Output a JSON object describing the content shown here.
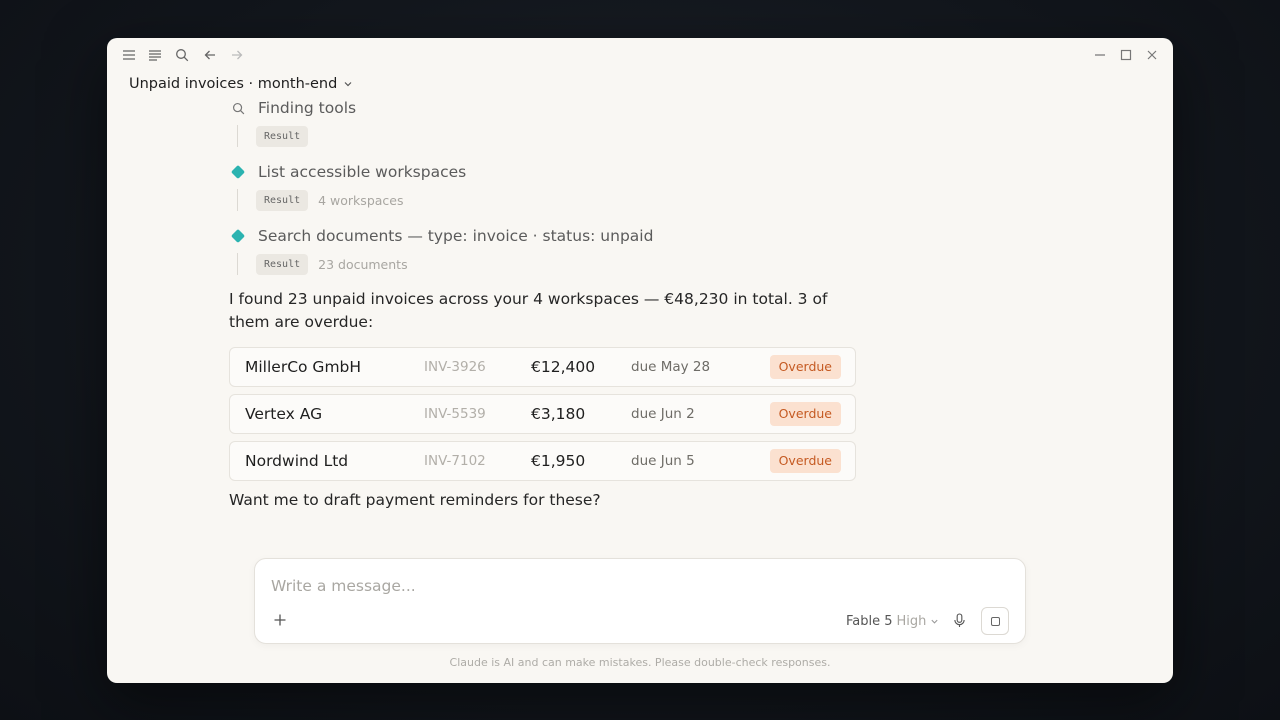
{
  "window": {
    "conversation_title": "Unpaid invoices · month-end"
  },
  "toolbar": {
    "icons": [
      "sidebar-toggle-icon",
      "menu-icon",
      "search-icon",
      "back-arrow-icon",
      "forward-arrow-icon"
    ],
    "window_controls": [
      "minimize-icon",
      "maximize-icon",
      "close-icon"
    ]
  },
  "steps": [
    {
      "icon": "search-icon",
      "label": "Finding tools",
      "result_label": "Result",
      "result_meta": ""
    },
    {
      "icon": "diamond-icon",
      "label": "List accessible workspaces",
      "result_label": "Result",
      "result_meta": "4 workspaces"
    },
    {
      "icon": "diamond-icon",
      "label": "Search documents — type: invoice · status: unpaid",
      "result_label": "Result",
      "result_meta": "23 documents"
    }
  ],
  "answer": {
    "summary": "I found 23 unpaid invoices across your 4 workspaces — €48,230 in total. 3 of them are overdue:",
    "followup": "Want me to draft payment reminders for these?"
  },
  "invoices": [
    {
      "company": "MillerCo GmbH",
      "id": "INV-3926",
      "amount": "€12,400",
      "due": "due May 28",
      "status": "Overdue"
    },
    {
      "company": "Vertex AG",
      "id": "INV-5539",
      "amount": "€3,180",
      "due": "due Jun 2",
      "status": "Overdue"
    },
    {
      "company": "Nordwind Ltd",
      "id": "INV-7102",
      "amount": "€1,950",
      "due": "due Jun 5",
      "status": "Overdue"
    }
  ],
  "composer": {
    "placeholder": "Write a message...",
    "model_name": "Fable 5",
    "model_level": "High"
  },
  "footer": {
    "disclaimer": "Claude is AI and can make mistakes. Please double-check responses."
  },
  "colors": {
    "accent": "#2bb3b0",
    "overdue_bg": "#fbe1d0",
    "overdue_text": "#c55a22",
    "window_bg": "#f9f7f3"
  }
}
